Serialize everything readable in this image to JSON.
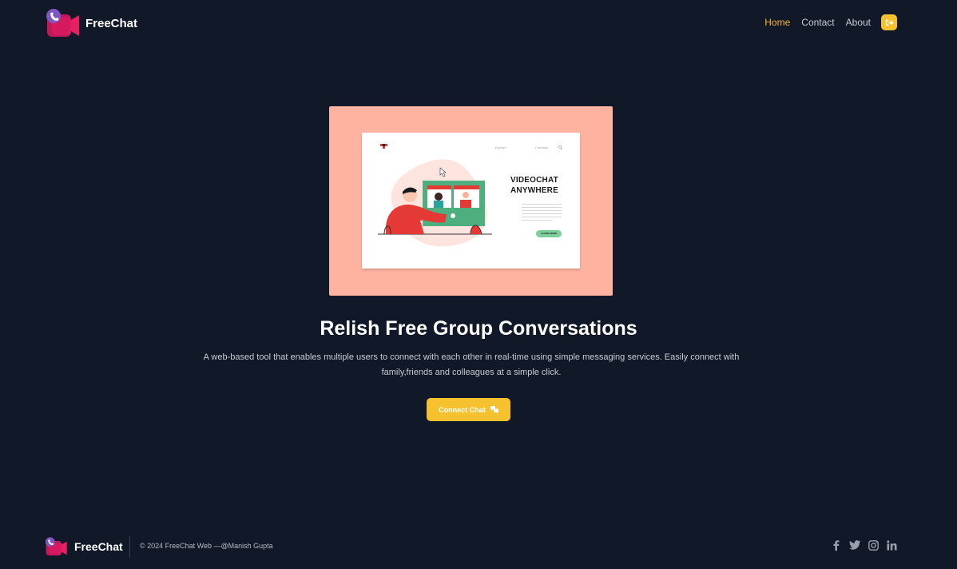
{
  "brand": {
    "name": "FreeChat",
    "logo_icon": "video-call-logo-icon"
  },
  "nav": {
    "items": [
      {
        "label": "Home",
        "active": true
      },
      {
        "label": "Contact",
        "active": false
      },
      {
        "label": "About",
        "active": false
      }
    ],
    "logout_icon": "sign-out-icon"
  },
  "hero": {
    "image": {
      "headline_line1": "VIDEOCHAT",
      "headline_line2": "ANYWHERE",
      "nav_explore": "Explore",
      "nav_contacts": "Contacts",
      "button": "LEARN MORE"
    },
    "title": "Relish Free Group Conversations",
    "description": "A web-based tool that enables multiple users to connect with each other in real-time using simple messaging services. Easily connect with family,friends and colleagues at a simple click.",
    "cta_label": "Connect Chat",
    "cta_icon": "chat-bubbles-icon"
  },
  "footer": {
    "brand": "FreeChat",
    "copyright": "© 2024 FreeChat Web —@Manish Gupta",
    "social": [
      "facebook-icon",
      "twitter-icon",
      "instagram-icon",
      "linkedin-icon"
    ]
  },
  "colors": {
    "background": "#111827",
    "accent": "#f5c12e",
    "active_nav": "#f5b82e",
    "hero_panel": "#feb2a0"
  }
}
